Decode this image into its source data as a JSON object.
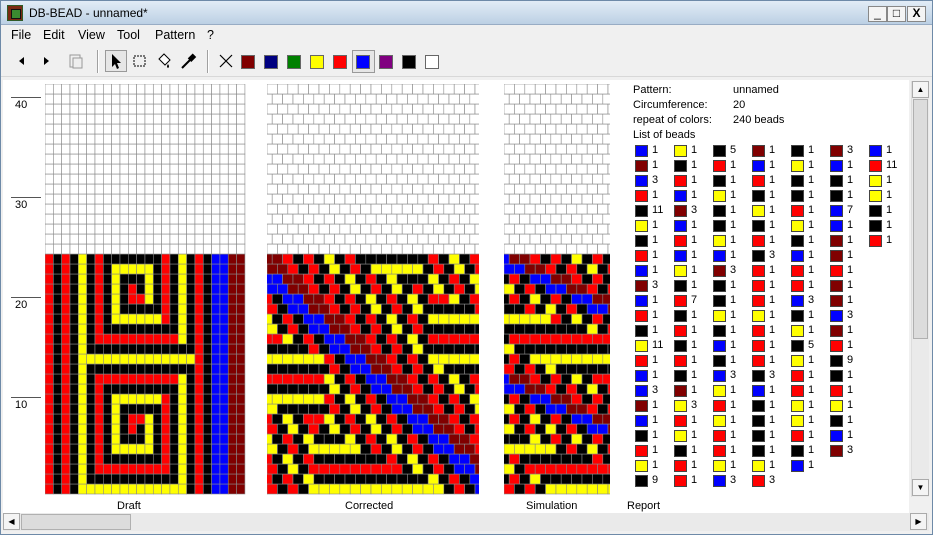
{
  "window": {
    "title": "DB-BEAD - unnamed*",
    "min": "_",
    "max": "□",
    "close": "X"
  },
  "menu": [
    "File",
    "Edit",
    "View",
    "Tool",
    "Pattern",
    "?"
  ],
  "toolbar": {
    "tools": [
      "prev-arrow",
      "next-arrow",
      "clipboard",
      "pointer-arrow",
      "select-rect",
      "fill-bucket",
      "color-picker"
    ],
    "colors": [
      "#800000",
      "#000080",
      "#008000",
      "#ffff00",
      "#ff0000",
      "#0000ff",
      "#800080",
      "#000000",
      "#ffffff"
    ],
    "selected_color": "#0000ff"
  },
  "ruler": {
    "labels": [
      "40",
      "30",
      "20",
      "10"
    ]
  },
  "panes": {
    "draft": "Draft",
    "corrected": "Corrected",
    "simulation": "Simulation",
    "report": "Report"
  },
  "palette": {
    "0": "#ffffff",
    "K": "#000000",
    "R": "#ff0000",
    "Y": "#ffff00",
    "B": "#0000ff",
    "M": "#800000"
  },
  "draft_rows": [
    "RKRKYYYYYYYYYYYYYKRKBBMM",
    "RKRKYKKKKKKKKKKKYKRKBBMM",
    "RKRKYKRRRRRRRRRKYKRKBBMM",
    "RKRKYKRKKKKKKKRKYKRKBBMM",
    "RKRKYKRKYYYYYKRKYKRKBBMM",
    "RKRKYKRKYKKKYKRKYKRKBBMM",
    "RKRKYKRKYKRKYKRKYKRKBBMM",
    "RKRKYKRKYKRRYKRKYKRKBBMM",
    "RKRKYKRKYKKKKKRKYKRKBBMM",
    "RKRKYKRKYYYYYYRKYKRKBBMM",
    "RKRKYKRKKKKKKKKKYKRKBBMM",
    "RKRKYKRRRRRRRRRRYKRKBBMM",
    "RKRKYKKKKKKKKKKKKKRKBBMM",
    "RKRKYYYYYYYYYYYYYYRKBBMM",
    "RKRKYKKKKKKKKKKKKKRKBBMM",
    "RKRKYKRRRRRRRRRRYKRKBBMM",
    "RKRKYKRKKKKKKKKKYKRKBBMM",
    "RKRKYKRKYYYYYYRKYKRKBBMM",
    "RKRKYKRKYKKKKKRKYKRKBBMM",
    "RKRKYKRKYKRRYKRKYKRKBBMM",
    "RKRKYKRKYKRKYKRKYKRKBBMM",
    "RKRKYKRKYKKKYKRKYKRKBBMM",
    "RKRKYKRKYYYYYKRKYKRKBBMM",
    "RKRKYKRKKKKKKKRKYKRKBBMM"
  ],
  "report": {
    "pattern_label": "Pattern:",
    "pattern_value": "unnamed",
    "circumference_label": "Circumference:",
    "circumference_value": "20",
    "repeat_label": "repeat of colors:",
    "repeat_value": "240 beads",
    "list_label": "List of beads",
    "columns": [
      [
        [
          "B",
          "1"
        ],
        [
          "M",
          "1"
        ],
        [
          "B",
          "3"
        ],
        [
          "R",
          "1"
        ],
        [
          "K",
          "11"
        ],
        [
          "Y",
          "1"
        ],
        [
          "K",
          "1"
        ],
        [
          "R",
          "1"
        ],
        [
          "B",
          "1"
        ],
        [
          "M",
          "3"
        ],
        [
          "B",
          "1"
        ],
        [
          "R",
          "1"
        ],
        [
          "K",
          "1"
        ],
        [
          "Y",
          "11"
        ],
        [
          "R",
          "1"
        ],
        [
          "B",
          "1"
        ],
        [
          "B",
          "3"
        ],
        [
          "M",
          "1"
        ],
        [
          "B",
          "1"
        ],
        [
          "K",
          "1"
        ],
        [
          "R",
          "1"
        ],
        [
          "Y",
          "1"
        ],
        [
          "K",
          "9"
        ]
      ],
      [
        [
          "Y",
          "1"
        ],
        [
          "K",
          "1"
        ],
        [
          "R",
          "1"
        ],
        [
          "B",
          "1"
        ],
        [
          "M",
          "3"
        ],
        [
          "B",
          "1"
        ],
        [
          "R",
          "1"
        ],
        [
          "B",
          "1"
        ],
        [
          "Y",
          "1"
        ],
        [
          "K",
          "1"
        ],
        [
          "R",
          "7"
        ],
        [
          "K",
          "1"
        ],
        [
          "R",
          "1"
        ],
        [
          "K",
          "1"
        ],
        [
          "R",
          "1"
        ],
        [
          "K",
          "1"
        ],
        [
          "M",
          "1"
        ],
        [
          "Y",
          "3"
        ],
        [
          "R",
          "1"
        ],
        [
          "Y",
          "1"
        ],
        [
          "K",
          "1"
        ],
        [
          "R",
          "1"
        ],
        [
          "R",
          "1"
        ]
      ],
      [
        [
          "K",
          "5"
        ],
        [
          "R",
          "1"
        ],
        [
          "K",
          "1"
        ],
        [
          "Y",
          "1"
        ],
        [
          "K",
          "1"
        ],
        [
          "K",
          "1"
        ],
        [
          "Y",
          "1"
        ],
        [
          "B",
          "1"
        ],
        [
          "M",
          "3"
        ],
        [
          "K",
          "1"
        ],
        [
          "K",
          "1"
        ],
        [
          "Y",
          "1"
        ],
        [
          "K",
          "1"
        ],
        [
          "B",
          "1"
        ],
        [
          "K",
          "1"
        ],
        [
          "B",
          "3"
        ],
        [
          "Y",
          "1"
        ],
        [
          "R",
          "1"
        ],
        [
          "Y",
          "1"
        ],
        [
          "R",
          "1"
        ],
        [
          "R",
          "1"
        ],
        [
          "Y",
          "1"
        ],
        [
          "B",
          "3"
        ]
      ],
      [
        [
          "M",
          "1"
        ],
        [
          "B",
          "1"
        ],
        [
          "R",
          "1"
        ],
        [
          "K",
          "1"
        ],
        [
          "Y",
          "1"
        ],
        [
          "K",
          "1"
        ],
        [
          "R",
          "1"
        ],
        [
          "K",
          "3"
        ],
        [
          "R",
          "1"
        ],
        [
          "R",
          "1"
        ],
        [
          "R",
          "1"
        ],
        [
          "Y",
          "1"
        ],
        [
          "R",
          "1"
        ],
        [
          "R",
          "1"
        ],
        [
          "R",
          "1"
        ],
        [
          "K",
          "3"
        ],
        [
          "B",
          "1"
        ],
        [
          "K",
          "1"
        ],
        [
          "K",
          "1"
        ],
        [
          "K",
          "1"
        ],
        [
          "K",
          "1"
        ],
        [
          "Y",
          "1"
        ],
        [
          "R",
          "3"
        ]
      ],
      [
        [
          "K",
          "1"
        ],
        [
          "Y",
          "1"
        ],
        [
          "K",
          "1"
        ],
        [
          "K",
          "1"
        ],
        [
          "R",
          "1"
        ],
        [
          "Y",
          "1"
        ],
        [
          "K",
          "1"
        ],
        [
          "B",
          "1"
        ],
        [
          "R",
          "1"
        ],
        [
          "R",
          "1"
        ],
        [
          "B",
          "3"
        ],
        [
          "K",
          "1"
        ],
        [
          "Y",
          "1"
        ],
        [
          "K",
          "5"
        ],
        [
          "Y",
          "1"
        ],
        [
          "R",
          "1"
        ],
        [
          "R",
          "1"
        ],
        [
          "Y",
          "1"
        ],
        [
          "Y",
          "1"
        ],
        [
          "R",
          "1"
        ],
        [
          "K",
          "1"
        ],
        [
          "B",
          "1"
        ]
      ],
      [
        [
          "M",
          "3"
        ],
        [
          "B",
          "1"
        ],
        [
          "K",
          "1"
        ],
        [
          "K",
          "1"
        ],
        [
          "B",
          "7"
        ],
        [
          "B",
          "1"
        ],
        [
          "M",
          "1"
        ],
        [
          "M",
          "1"
        ],
        [
          "R",
          "1"
        ],
        [
          "M",
          "1"
        ],
        [
          "M",
          "1"
        ],
        [
          "B",
          "3"
        ],
        [
          "M",
          "1"
        ],
        [
          "R",
          "1"
        ],
        [
          "K",
          "9"
        ],
        [
          "K",
          "1"
        ],
        [
          "R",
          "1"
        ],
        [
          "Y",
          "1"
        ],
        [
          "K",
          "1"
        ],
        [
          "B",
          "1"
        ],
        [
          "M",
          "3"
        ]
      ],
      [
        [
          "B",
          "1"
        ],
        [
          "R",
          "11"
        ],
        [
          "Y",
          "1"
        ],
        [
          "Y",
          "1"
        ],
        [
          "K",
          "1"
        ],
        [
          "K",
          "1"
        ],
        [
          "R",
          "1"
        ]
      ]
    ]
  }
}
